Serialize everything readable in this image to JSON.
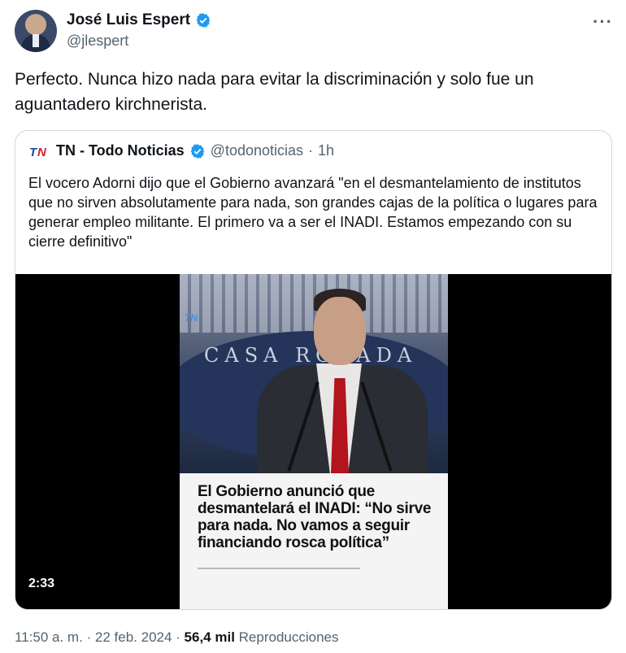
{
  "author": {
    "name": "José Luis Espert",
    "handle": "@jlespert"
  },
  "tweet": {
    "text": "Perfecto. Nunca hizo nada para evitar la discriminación y solo fue un aguantadero kirchnerista."
  },
  "quote": {
    "name": "TN - Todo Noticias",
    "handle": "@todonoticias",
    "separator": "·",
    "time": "1h",
    "text": "El vocero Adorni dijo que el Gobierno avanzará \"en el desmantelamiento de institutos que no sirven absolutamente para nada, son grandes cajas de la política o lugares para generar empleo militante. El primero va a ser el INADI. Estamos empezando con su cierre definitivo\"",
    "video": {
      "duration": "2:33",
      "backdrop_text": "CASA ROSADA",
      "caption": "El Gobierno anunció que desmantelará el INADI: “No sirve para nada. No vamos a seguir financiando rosca política”"
    }
  },
  "footer": {
    "time": "11:50 a. m.",
    "separator1": " · ",
    "date": "22 feb. 2024",
    "separator2": " · ",
    "views_count": "56,4 mil",
    "views_label": " Reproducciones"
  },
  "colors": {
    "text": "#0f1419",
    "secondary": "#536471",
    "verified": "#1d9bf0",
    "border": "#cfd9de"
  }
}
